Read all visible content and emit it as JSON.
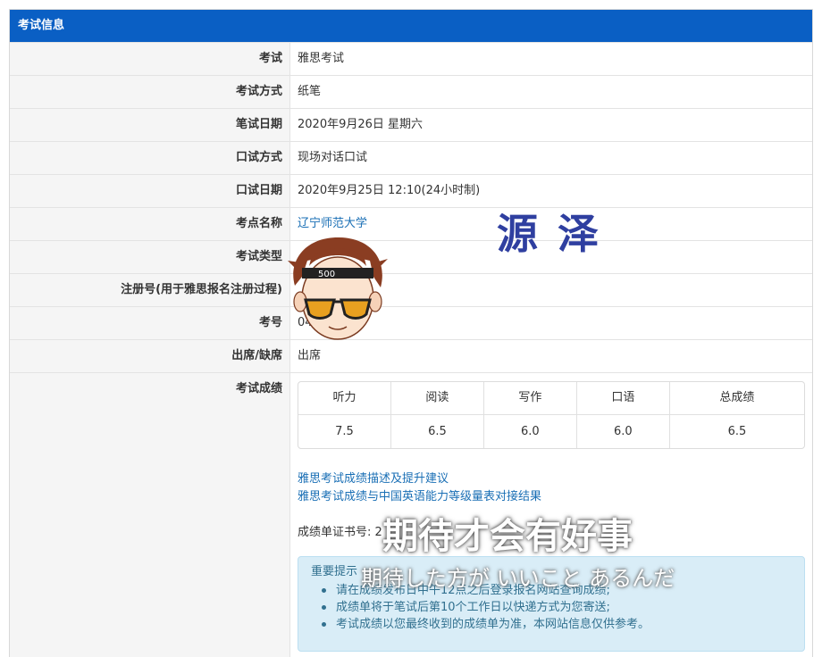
{
  "panel": {
    "title": "考试信息"
  },
  "rows": [
    {
      "label": "考试",
      "value": "雅思考试"
    },
    {
      "label": "考试方式",
      "value": "纸笔"
    },
    {
      "label": "笔试日期",
      "value": "2020年9月26日 星期六"
    },
    {
      "label": "口试方式",
      "value": "现场对话口试"
    },
    {
      "label": "口试日期",
      "value": "2020年9月25日 12:10(24小时制)"
    },
    {
      "label": "考点名称",
      "value": "辽宁师范大学"
    },
    {
      "label": "考试类型",
      "value": ""
    },
    {
      "label": "注册号(用于雅思报名注册过程)",
      "value": ""
    },
    {
      "label": "考号",
      "value": "04"
    },
    {
      "label": "出席/缺席",
      "value": "出席"
    }
  ],
  "scores": {
    "label": "考试成绩",
    "headers": [
      "听力",
      "阅读",
      "写作",
      "口语",
      "总成绩"
    ],
    "values": [
      "7.5",
      "6.5",
      "6.0",
      "6.0",
      "6.5"
    ]
  },
  "links": [
    "雅思考试成绩描述及提升建议",
    "雅思考试成绩与中国英语能力等级量表对接结果"
  ],
  "certificate": {
    "label": "成绩单证书号: 2"
  },
  "notice": {
    "title": "重要提示",
    "items": [
      "请在成绩发布日中午12点之后登录报名网站查询成绩;",
      "成绩单将于笔试后第10个工作日以快递方式为您寄送;",
      "考试成绩以您最终收到的成绩单为准，本网站信息仅供参考。"
    ]
  },
  "overlay": {
    "name": "源泽",
    "subtitle_main": "期待才会有好事",
    "subtitle_jp": "期待した方が いいこと あるんだ"
  },
  "colors": {
    "header": "#0a5fc4",
    "link": "#1a6fb5",
    "notice_bg": "#d9edf7",
    "watermark": "#2f3fa0"
  }
}
